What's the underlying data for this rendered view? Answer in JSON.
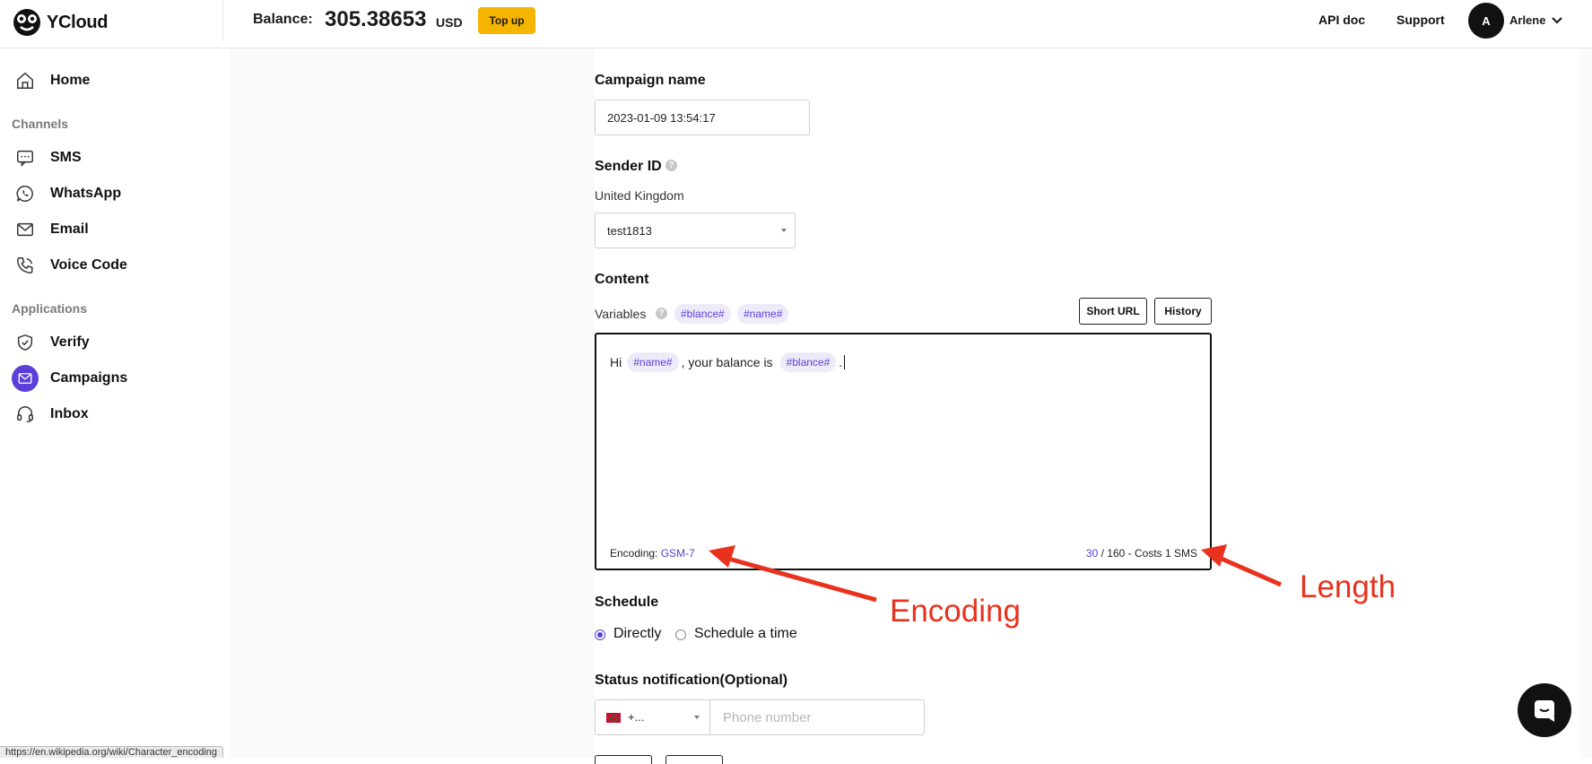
{
  "brand": {
    "name": "YCloud"
  },
  "header": {
    "balance_label": "Balance:",
    "balance_value": "305.38653",
    "balance_unit": "USD",
    "topup_label": "Top up",
    "api_doc": "API doc",
    "support": "Support",
    "avatar_initial": "A",
    "user_name": "Arlene"
  },
  "sidebar": {
    "home": "Home",
    "channels_title": "Channels",
    "channels": [
      {
        "label": "SMS",
        "icon": "sms-icon"
      },
      {
        "label": "WhatsApp",
        "icon": "whatsapp-icon"
      },
      {
        "label": "Email",
        "icon": "email-icon"
      },
      {
        "label": "Voice Code",
        "icon": "phone-icon"
      }
    ],
    "applications_title": "Applications",
    "applications": [
      {
        "label": "Verify",
        "icon": "shield-icon"
      },
      {
        "label": "Campaigns",
        "icon": "campaign-icon",
        "active": true
      },
      {
        "label": "Inbox",
        "icon": "headset-icon"
      }
    ]
  },
  "form": {
    "campaign_name_title": "Campaign name",
    "campaign_name_value": "2023-01-09 13:54:17",
    "sender_title": "Sender ID",
    "sender_country": "United Kingdom",
    "sender_value": "test1813",
    "content_title": "Content",
    "variables_label": "Variables",
    "variables": [
      "#blance#",
      "#name#"
    ],
    "short_url_label": "Short URL",
    "history_label": "History",
    "message": {
      "part1": "Hi",
      "var1": "#name#",
      "part2": ", your balance is",
      "var2": "#blance#",
      "part3": "."
    },
    "encoding_label": "Encoding:",
    "encoding_value": "GSM-7",
    "length_count": "30",
    "length_rest": "/ 160 - Costs 1 SMS",
    "schedule_title": "Schedule",
    "schedule_options": [
      "Directly",
      "Schedule a time"
    ],
    "schedule_selected": "Directly",
    "status_title": "Status notification(Optional)",
    "country_code": "+...",
    "phone_placeholder": "Phone number"
  },
  "annotations": {
    "encoding": "Encoding",
    "length": "Length",
    "color": "#e8321e"
  },
  "status_bar_url": "https://en.wikipedia.org/wiki/Character_encoding",
  "colors": {
    "accent": "#5b3fd9",
    "topup": "#f5b400"
  }
}
